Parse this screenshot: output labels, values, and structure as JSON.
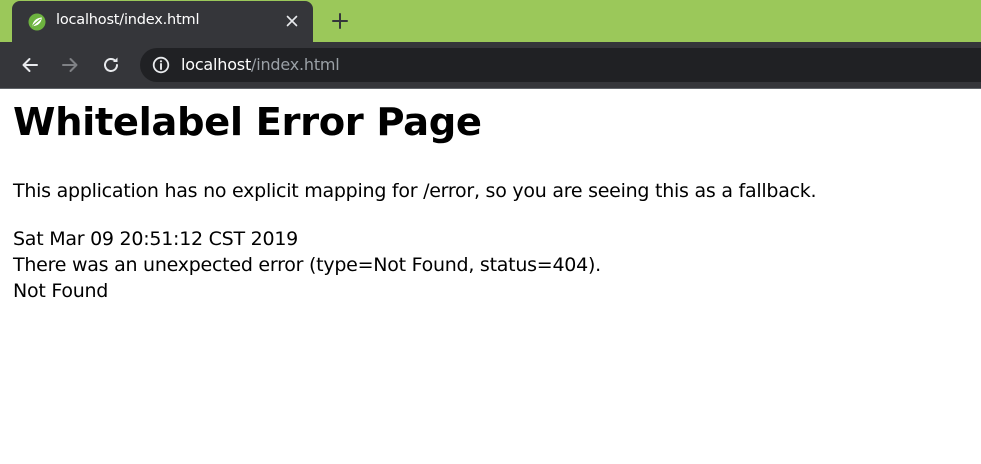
{
  "browser": {
    "tab": {
      "title": "localhost/index.html",
      "favicon": "spring-leaf-icon"
    },
    "address_bar": {
      "host": "localhost",
      "path": "/index.html"
    },
    "colors": {
      "tabstrip": "#9bc85a",
      "toolbar": "#35363a",
      "omnibox": "#202124",
      "favicon": "#6db33f"
    }
  },
  "page": {
    "title": "Whitelabel Error Page",
    "message": "This application has no explicit mapping for /error, so you are seeing this as a fallback.",
    "details": {
      "timestamp": "Sat Mar 09 20:51:12 CST 2019",
      "error": "There was an unexpected error (type=Not Found, status=404).",
      "reason": "Not Found"
    }
  }
}
